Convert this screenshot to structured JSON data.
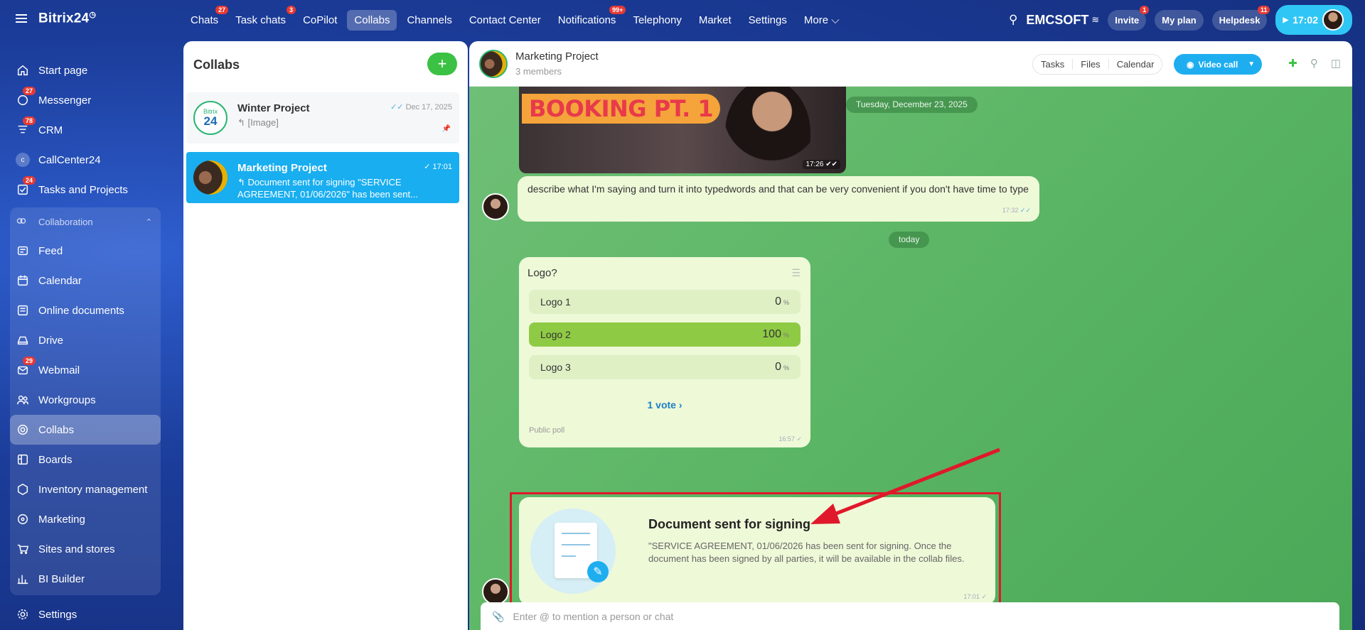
{
  "app": {
    "brand": "Bitrix24",
    "brand_mark": "◷"
  },
  "sidebar": {
    "items": [
      {
        "label": "Start page",
        "icon": "home-icon",
        "badge": ""
      },
      {
        "label": "Messenger",
        "icon": "messenger-icon",
        "badge": "27"
      },
      {
        "label": "CRM",
        "icon": "crm-icon",
        "badge": "78"
      },
      {
        "label": "CallCenter24",
        "icon": "callcenter-icon",
        "badge": "",
        "mark": "c"
      },
      {
        "label": "Tasks and Projects",
        "icon": "tasks-icon",
        "badge": "24"
      }
    ],
    "group_title": "Collaboration",
    "group_items": [
      {
        "label": "Feed",
        "icon": "feed-icon",
        "badge": ""
      },
      {
        "label": "Calendar",
        "icon": "calendar-icon",
        "badge": ""
      },
      {
        "label": "Online documents",
        "icon": "documents-icon",
        "badge": ""
      },
      {
        "label": "Drive",
        "icon": "drive-icon",
        "badge": ""
      },
      {
        "label": "Webmail",
        "icon": "webmail-icon",
        "badge": "29"
      },
      {
        "label": "Workgroups",
        "icon": "workgroups-icon",
        "badge": ""
      },
      {
        "label": "Collabs",
        "icon": "collabs-icon",
        "badge": "",
        "active": true
      },
      {
        "label": "Boards",
        "icon": "boards-icon",
        "badge": ""
      },
      {
        "label": "Inventory management",
        "icon": "inventory-icon",
        "badge": ""
      },
      {
        "label": "Marketing",
        "icon": "marketing-icon",
        "badge": ""
      },
      {
        "label": "Sites and stores",
        "icon": "stores-icon",
        "badge": ""
      },
      {
        "label": "BI Builder",
        "icon": "bi-builder-icon",
        "badge": ""
      }
    ],
    "settings_label": "Settings"
  },
  "topnav": {
    "items": [
      {
        "label": "Chats",
        "badge": "27"
      },
      {
        "label": "Task chats",
        "badge": "3"
      },
      {
        "label": "CoPilot",
        "badge": ""
      },
      {
        "label": "Collabs",
        "badge": "",
        "active": true
      },
      {
        "label": "Channels",
        "badge": ""
      },
      {
        "label": "Contact Center",
        "badge": ""
      },
      {
        "label": "Notifications",
        "badge": "99+"
      },
      {
        "label": "Telephony",
        "badge": ""
      },
      {
        "label": "Market",
        "badge": ""
      },
      {
        "label": "Settings",
        "badge": ""
      },
      {
        "label": "More ⌵",
        "badge": ""
      }
    ],
    "org": "EMCSOFT",
    "invite": "Invite",
    "invite_badge": "1",
    "myplan": "My plan",
    "helpdesk": "Helpdesk",
    "helpdesk_badge": "11",
    "time": "17:02"
  },
  "collabs": {
    "title": "Collabs",
    "add": "+",
    "items": [
      {
        "name": "Winter Project",
        "last": "↰ [Image]",
        "date": "Dec 17, 2025",
        "avatar_top": "Bitrix",
        "avatar_main": "24"
      },
      {
        "name": "Marketing Project",
        "last": "↰ Document sent for signing \"SERVICE AGREEMENT, 01/06/2026\" has been sent...",
        "date": "17:01"
      }
    ]
  },
  "chat": {
    "title": "Marketing Project",
    "subtitle": "3 members",
    "tabs": [
      "Tasks",
      "Files",
      "Calendar"
    ],
    "video_call": "Video call",
    "media_text": "BOOKING PT. 1",
    "media_time": "17:26 ✔✔",
    "date1": "Tuesday, December 23, 2025",
    "msg1": "describe what I'm saying and turn it into typedwords and that can be very convenient if you don't have time to type",
    "msg1_time": "17:32",
    "date2": "today",
    "poll": {
      "question": "Logo?",
      "options": [
        {
          "label": "Logo 1",
          "pct": "0"
        },
        {
          "label": "Logo 2",
          "pct": "100"
        },
        {
          "label": "Logo 3",
          "pct": "0"
        }
      ],
      "pct_sign": "%",
      "votes": "1 vote",
      "public": "Public poll",
      "time": "16:57"
    },
    "doc": {
      "title": "Document sent for signing",
      "text": "\"SERVICE AGREEMENT, 01/06/2026 has been sent for signing. Once the document has been signed by all parties, it will be available in the collab files.",
      "time": "17:01"
    },
    "composer_placeholder": "Enter @ to mention a person or chat"
  }
}
